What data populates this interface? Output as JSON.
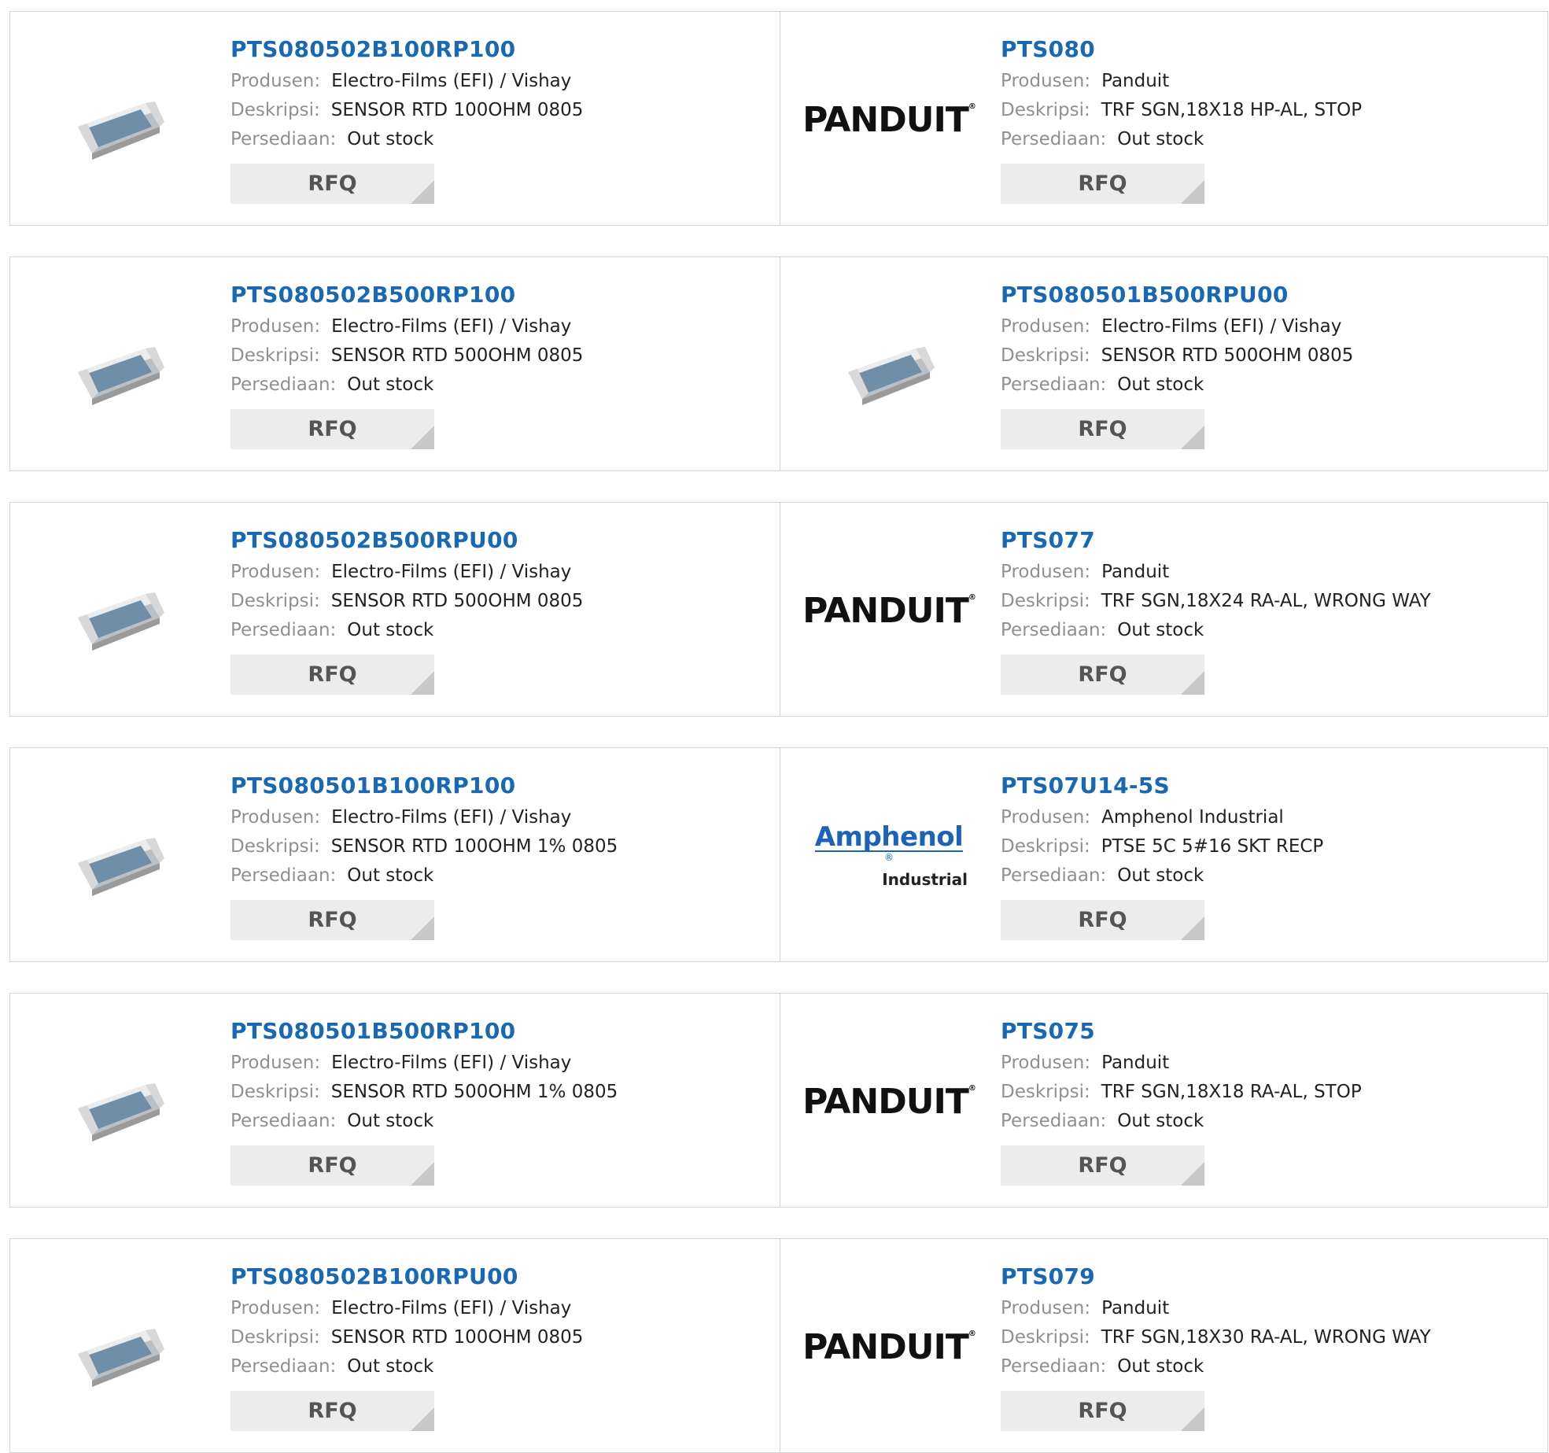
{
  "labels": {
    "manufacturer": "Produsen:",
    "description": "Deskripsi:",
    "stock": "Persediaan:",
    "rfq": "RFQ"
  },
  "rows": [
    {
      "left": {
        "part": "PTS080502B100RP100",
        "manufacturer": "Electro-Films (EFI) / Vishay",
        "description": "SENSOR RTD 100OHM 0805",
        "stock": "Out stock",
        "image": "chip-resistor"
      },
      "right": {
        "part": "PTS080",
        "manufacturer": "Panduit",
        "description": "TRF SGN,18X18 HP-AL, STOP",
        "stock": "Out stock",
        "image": "panduit-logo"
      }
    },
    {
      "left": {
        "part": "PTS080502B500RP100",
        "manufacturer": "Electro-Films (EFI) / Vishay",
        "description": "SENSOR RTD 500OHM 0805",
        "stock": "Out stock",
        "image": "chip-resistor"
      },
      "right": {
        "part": "PTS080501B500RPU00",
        "manufacturer": "Electro-Films (EFI) / Vishay",
        "description": "SENSOR RTD 500OHM 0805",
        "stock": "Out stock",
        "image": "chip-resistor"
      }
    },
    {
      "left": {
        "part": "PTS080502B500RPU00",
        "manufacturer": "Electro-Films (EFI) / Vishay",
        "description": "SENSOR RTD 500OHM 0805",
        "stock": "Out stock",
        "image": "chip-resistor"
      },
      "right": {
        "part": "PTS077",
        "manufacturer": "Panduit",
        "description": "TRF SGN,18X24 RA-AL, WRONG WAY",
        "stock": "Out stock",
        "image": "panduit-logo"
      }
    },
    {
      "left": {
        "part": "PTS080501B100RP100",
        "manufacturer": "Electro-Films (EFI) / Vishay",
        "description": "SENSOR RTD 100OHM 1% 0805",
        "stock": "Out stock",
        "image": "chip-resistor"
      },
      "right": {
        "part": "PTS07U14-5S",
        "manufacturer": "Amphenol Industrial",
        "description": "PTSE 5C 5#16 SKT RECP",
        "stock": "Out stock",
        "image": "amphenol-logo"
      }
    },
    {
      "left": {
        "part": "PTS080501B500RP100",
        "manufacturer": "Electro-Films (EFI) / Vishay",
        "description": "SENSOR RTD 500OHM 1% 0805",
        "stock": "Out stock",
        "image": "chip-resistor"
      },
      "right": {
        "part": "PTS075",
        "manufacturer": "Panduit",
        "description": "TRF SGN,18X18 RA-AL, STOP",
        "stock": "Out stock",
        "image": "panduit-logo"
      }
    },
    {
      "left": {
        "part": "PTS080502B100RPU00",
        "manufacturer": "Electro-Films (EFI) / Vishay",
        "description": "SENSOR RTD 100OHM 0805",
        "stock": "Out stock",
        "image": "chip-resistor"
      },
      "right": {
        "part": "PTS079",
        "manufacturer": "Panduit",
        "description": "TRF SGN,18X30 RA-AL, WRONG WAY",
        "stock": "Out stock",
        "image": "panduit-logo"
      }
    }
  ],
  "logos": {
    "panduit": "PANDUIT",
    "amphenol_1": "Amphenol",
    "amphenol_2": "Industrial"
  },
  "colors": {
    "part_link": "#1868b4",
    "label": "#909090",
    "rfq_bg": "#ececec"
  }
}
